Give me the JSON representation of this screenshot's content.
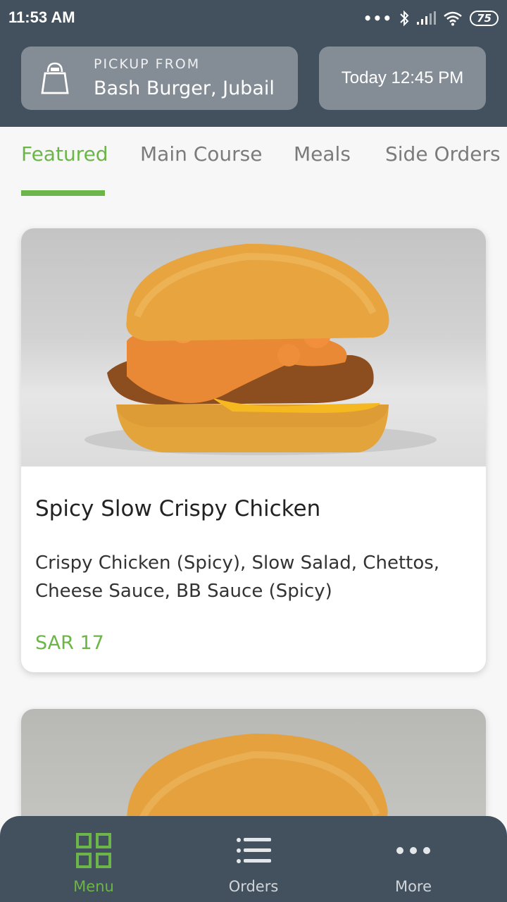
{
  "status_bar": {
    "time": "11:53 AM",
    "dots": "•••",
    "battery": "75",
    "icons": [
      "bluetooth-icon",
      "signal-icon",
      "wifi-icon",
      "battery-icon"
    ]
  },
  "header": {
    "pickup_label": "PICKUP FROM",
    "pickup_location": "Bash Burger, Jubail",
    "pickup_time": "Today 12:45 PM"
  },
  "tabs": [
    {
      "label": "Featured",
      "active": true
    },
    {
      "label": "Main Course",
      "active": false
    },
    {
      "label": "Meals",
      "active": false
    },
    {
      "label": "Side Orders",
      "active": false
    }
  ],
  "menu_items": [
    {
      "name": "Spicy Slow Crispy Chicken",
      "description": "Crispy Chicken (Spicy), Slow Salad, Chettos, Cheese Sauce, BB Sauce (Spicy)",
      "price": "SAR 17"
    }
  ],
  "bottom_nav": [
    {
      "label": "Menu",
      "icon": "grid-icon",
      "active": true
    },
    {
      "label": "Orders",
      "icon": "list-icon",
      "active": false
    },
    {
      "label": "More",
      "icon": "more-dots-icon",
      "active": false
    }
  ],
  "colors": {
    "header_bg": "#43505d",
    "card_bg": "#848d96",
    "accent_green": "#6cb548"
  }
}
